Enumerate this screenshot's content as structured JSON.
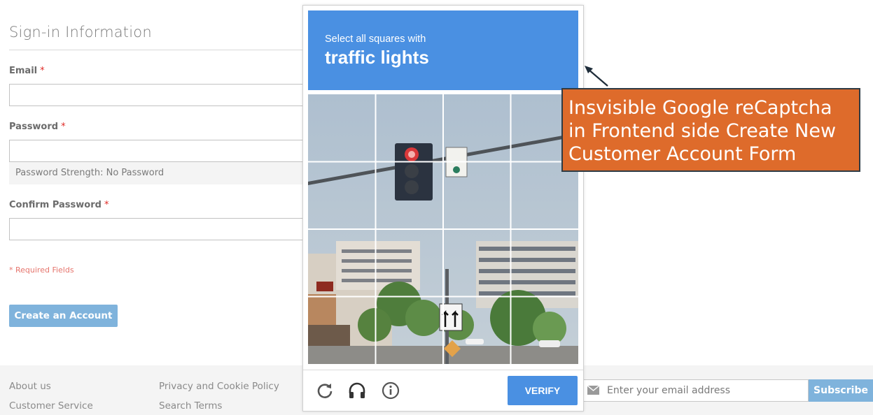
{
  "form": {
    "title": "Sign-in Information",
    "email_label": "Email",
    "password_label": "Password",
    "password_strength": "Password Strength: No Password",
    "confirm_label": "Confirm Password",
    "required_mark": "*",
    "required_note": "* Required Fields",
    "create_button": "Create an Account"
  },
  "captcha": {
    "instruction": "Select all squares with",
    "target": "traffic lights",
    "verify_label": "VERIFY",
    "icons": [
      "reload-icon",
      "audio-headphones-icon",
      "info-icon"
    ],
    "header_color": "#4a90e2"
  },
  "annotation": {
    "lines": [
      "Insvisible Google reCaptcha",
      "in Frontend side Create New",
      "Customer Account Form"
    ],
    "color": "#de6b2b"
  },
  "footer": {
    "links_col1": [
      "About us",
      "Customer Service"
    ],
    "links_col2": [
      "Privacy and Cookie Policy",
      "Search Terms"
    ],
    "newsletter_placeholder": "Enter your email address",
    "subscribe_label": "Subscribe"
  }
}
